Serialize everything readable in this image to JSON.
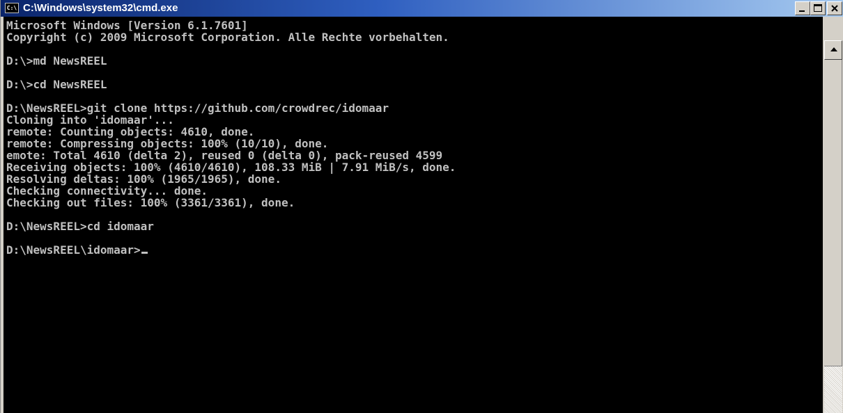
{
  "window": {
    "title": "C:\\Windows\\system32\\cmd.exe",
    "icon_label": "C:\\",
    "icon": "cmd-app-icon",
    "caption_buttons": [
      "minimize-icon",
      "maximize-icon",
      "close-icon"
    ]
  },
  "console": {
    "lines": [
      "Microsoft Windows [Version 6.1.7601]",
      "Copyright (c) 2009 Microsoft Corporation. Alle Rechte vorbehalten.",
      "",
      "D:\\>md NewsREEL",
      "",
      "D:\\>cd NewsREEL",
      "",
      "D:\\NewsREEL>git clone https://github.com/crowdrec/idomaar",
      "Cloning into 'idomaar'...",
      "remote: Counting objects: 4610, done.",
      "remote: Compressing objects: 100% (10/10), done.",
      "emote: Total 4610 (delta 2), reused 0 (delta 0), pack-reused 4599",
      "Receiving objects: 100% (4610/4610), 108.33 MiB | 7.91 MiB/s, done.",
      "Resolving deltas: 100% (1965/1965), done.",
      "Checking connectivity... done.",
      "Checking out files: 100% (3361/3361), done.",
      "",
      "D:\\NewsREEL>cd idomaar",
      "",
      "D:\\NewsREEL\\idomaar>"
    ]
  },
  "colors": {
    "console_bg": "#000000",
    "console_fg": "#c0c0c0",
    "titlebar_start": "#0a246a",
    "titlebar_end": "#a6caf0"
  }
}
